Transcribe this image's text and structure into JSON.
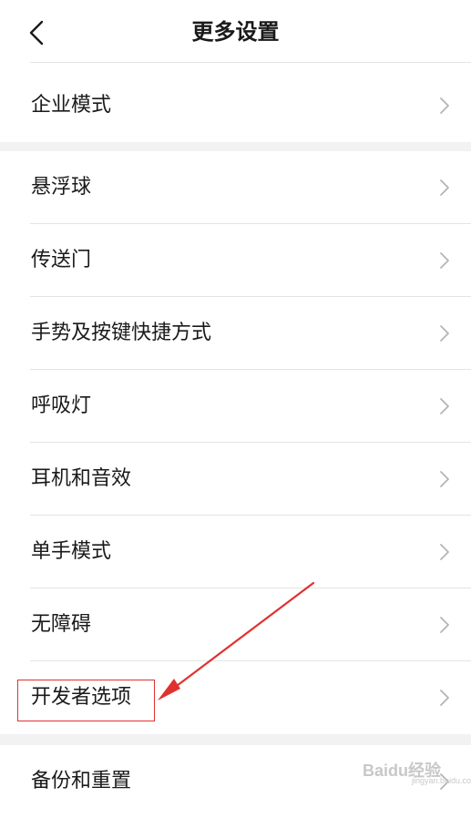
{
  "header": {
    "title": "更多设置",
    "back_icon": "chevron-left-icon"
  },
  "group1": {
    "items": [
      {
        "label": "企业模式"
      }
    ]
  },
  "group2": {
    "items": [
      {
        "label": "悬浮球"
      },
      {
        "label": "传送门"
      },
      {
        "label": "手势及按键快捷方式"
      },
      {
        "label": "呼吸灯"
      },
      {
        "label": "耳机和音效"
      },
      {
        "label": "单手模式"
      },
      {
        "label": "无障碍"
      },
      {
        "label": "开发者选项"
      }
    ]
  },
  "group3": {
    "items": [
      {
        "label": "备份和重置"
      }
    ]
  },
  "annotation": {
    "color": "#e0312f",
    "target": "开发者选项"
  },
  "watermark": {
    "text": "Baidu经验",
    "sub": "jingyan.baidu.com"
  },
  "colors": {
    "background": "#ffffff",
    "section_gap": "#f2f2f2",
    "divider": "#e4e4e4",
    "text": "#1a1a1a",
    "chevron": "#b5b5b5"
  }
}
